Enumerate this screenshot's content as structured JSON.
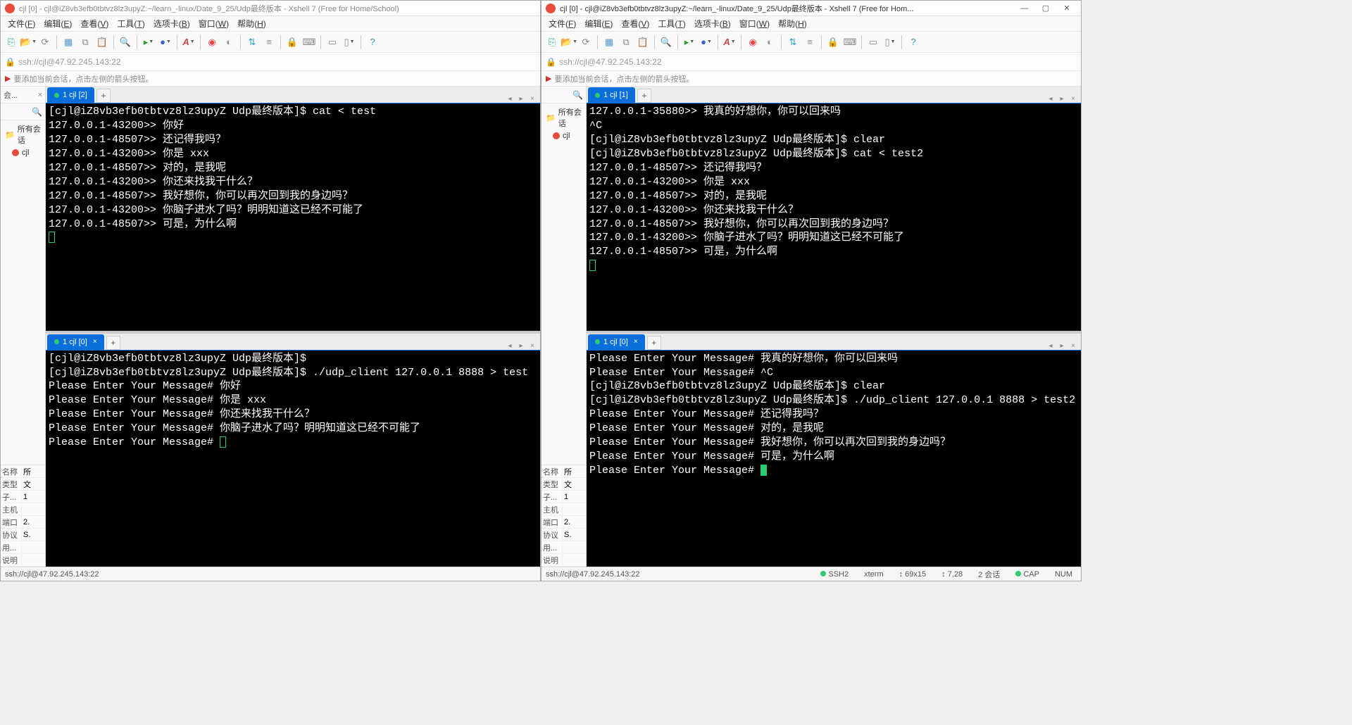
{
  "left": {
    "title": "cjl [0] - cjl@iZ8vb3efb0tbtvz8lz3upyZ:~/learn_-linux/Date_9_25/Udp最终版本 - Xshell 7 (Free for Home/School)",
    "address": "ssh://cjl@47.92.245.143:22",
    "hint": "要添加当前会话，点击左侧的箭头按钮。",
    "sidebar": {
      "title": "会...",
      "root": "所有会话",
      "session": "cjl"
    },
    "menus": [
      "文件(F)",
      "编辑(E)",
      "查看(V)",
      "工具(T)",
      "选项卡(B)",
      "窗口(W)",
      "帮助(H)"
    ],
    "tab_top": "1 cjl [2]",
    "term_top": "[cjl@iZ8vb3efb0tbtvz8lz3upyZ Udp最终版本]$ cat < test\n127.0.0.1-43200>> 你好\n127.0.0.1-48507>> 还记得我吗？\n127.0.0.1-43200>> 你是 xxx\n127.0.0.1-48507>> 对的，是我呢\n127.0.0.1-43200>> 你还来找我干什么？\n127.0.0.1-48507>> 我好想你，你可以再次回到我的身边吗？\n127.0.0.1-43200>> 你脑子进水了吗？明明知道这已经不可能了\n127.0.0.1-48507>> 可是，为什么啊",
    "tab_bot": "1 cjl [0]",
    "term_bot": "[cjl@iZ8vb3efb0tbtvz8lz3upyZ Udp最终版本]$ \n[cjl@iZ8vb3efb0tbtvz8lz3upyZ Udp最终版本]$ ./udp_client 127.0.0.1 8888 > test\nPlease Enter Your Message# 你好\nPlease Enter Your Message# 你是 xxx\nPlease Enter Your Message# 你还来找我干什么？\nPlease Enter Your Message# 你脑子进水了吗？明明知道这已经不可能了\nPlease Enter Your Message# ",
    "props": [
      [
        "名称",
        "所"
      ],
      [
        "类型",
        "文"
      ],
      [
        "子...",
        "1"
      ],
      [
        "主机",
        ""
      ],
      [
        "端口",
        "2."
      ],
      [
        "协议",
        "S."
      ],
      [
        "用...",
        ""
      ],
      [
        "说明",
        ""
      ]
    ],
    "status": "ssh://cjl@47.92.245.143:22"
  },
  "right": {
    "title": "cjl [0] - cjl@iZ8vb3efb0tbtvz8lz3upyZ:~/learn_-linux/Date_9_25/Udp最终版本 - Xshell 7 (Free for Hom...",
    "address": "ssh://cjl@47.92.245.143:22",
    "hint": "要添加当前会话，点击左侧的箭头按钮。",
    "sidebar": {
      "root": "所有会话",
      "session": "cjl"
    },
    "menus": [
      "文件(F)",
      "编辑(E)",
      "查看(V)",
      "工具(T)",
      "选项卡(B)",
      "窗口(W)",
      "帮助(H)"
    ],
    "tab_top": "1 cjl [1]",
    "term_top": "127.0.0.1-35880>> 我真的好想你，你可以回来吗\n^C\n[cjl@iZ8vb3efb0tbtvz8lz3upyZ Udp最终版本]$ clear\n[cjl@iZ8vb3efb0tbtvz8lz3upyZ Udp最终版本]$ cat < test2\n127.0.0.1-48507>> 还记得我吗？\n127.0.0.1-43200>> 你是 xxx\n127.0.0.1-48507>> 对的，是我呢\n127.0.0.1-43200>> 你还来找我干什么？\n127.0.0.1-48507>> 我好想你，你可以再次回到我的身边吗？\n127.0.0.1-43200>> 你脑子进水了吗？明明知道这已经不可能了\n127.0.0.1-48507>> 可是，为什么啊",
    "tab_bot": "1 cjl [0]",
    "term_bot": "Please Enter Your Message# 我真的好想你，你可以回来吗\nPlease Enter Your Message# ^C\n[cjl@iZ8vb3efb0tbtvz8lz3upyZ Udp最终版本]$ clear\n[cjl@iZ8vb3efb0tbtvz8lz3upyZ Udp最终版本]$ ./udp_client 127.0.0.1 8888 > test2\nPlease Enter Your Message# 还记得我吗？\nPlease Enter Your Message# 对的，是我呢\nPlease Enter Your Message# 我好想你，你可以再次回到我的身边吗？\nPlease Enter Your Message# 可是，为什么啊\nPlease Enter Your Message# ",
    "props": [
      [
        "名称",
        "所"
      ],
      [
        "类型",
        "文"
      ],
      [
        "子...",
        "1"
      ],
      [
        "主机",
        ""
      ],
      [
        "端口",
        "2."
      ],
      [
        "协议",
        "S."
      ],
      [
        "用...",
        ""
      ],
      [
        "说明",
        ""
      ]
    ],
    "status": {
      "addr": "ssh://cjl@47.92.245.143:22",
      "proto": "SSH2",
      "term": "xterm",
      "size": "↕ 69x15",
      "pos": "↕ 7,28",
      "sess": "2 会话",
      "caps": "CAP",
      "num": "NUM"
    }
  },
  "toolbar_icons": [
    {
      "name": "new-session-icon",
      "g": "⎘",
      "c": "#2a8"
    },
    {
      "name": "open-icon",
      "g": "📂",
      "c": "#c90",
      "dd": true
    },
    {
      "name": "reconnect-icon",
      "g": "⟳",
      "c": "#888"
    },
    {
      "sep": true
    },
    {
      "name": "properties-icon",
      "g": "▦",
      "c": "#59c"
    },
    {
      "name": "copy-icon",
      "g": "⧉",
      "c": "#888"
    },
    {
      "name": "paste-icon",
      "g": "📋",
      "c": "#888"
    },
    {
      "sep": true
    },
    {
      "name": "find-icon",
      "g": "🔍",
      "c": "#888"
    },
    {
      "sep": true
    },
    {
      "name": "xftp-icon",
      "g": "▸",
      "c": "#393",
      "dd": true
    },
    {
      "name": "globe-icon",
      "g": "●",
      "c": "#36c",
      "dd": true
    },
    {
      "sep": true
    },
    {
      "name": "font-icon",
      "g": "A",
      "c": "#c44",
      "dd": true,
      "i": true
    },
    {
      "sep": true
    },
    {
      "name": "xagent-icon",
      "g": "◉",
      "c": "#e44"
    },
    {
      "name": "color-icon",
      "g": "◐",
      "c": "#888"
    },
    {
      "sep": true
    },
    {
      "name": "transfer-icon",
      "g": "⇅",
      "c": "#39c"
    },
    {
      "name": "script-icon",
      "g": "≡",
      "c": "#888"
    },
    {
      "sep": true
    },
    {
      "name": "lock-icon",
      "g": "🔒",
      "c": "#888"
    },
    {
      "name": "keyboard-icon",
      "g": "⌨",
      "c": "#888"
    },
    {
      "sep": true
    },
    {
      "name": "tile-h-icon",
      "g": "▭",
      "c": "#888"
    },
    {
      "name": "tile-v-icon",
      "g": "▯",
      "c": "#888",
      "dd": true
    },
    {
      "sep": true
    },
    {
      "name": "help-icon",
      "g": "?",
      "c": "#39c"
    }
  ]
}
